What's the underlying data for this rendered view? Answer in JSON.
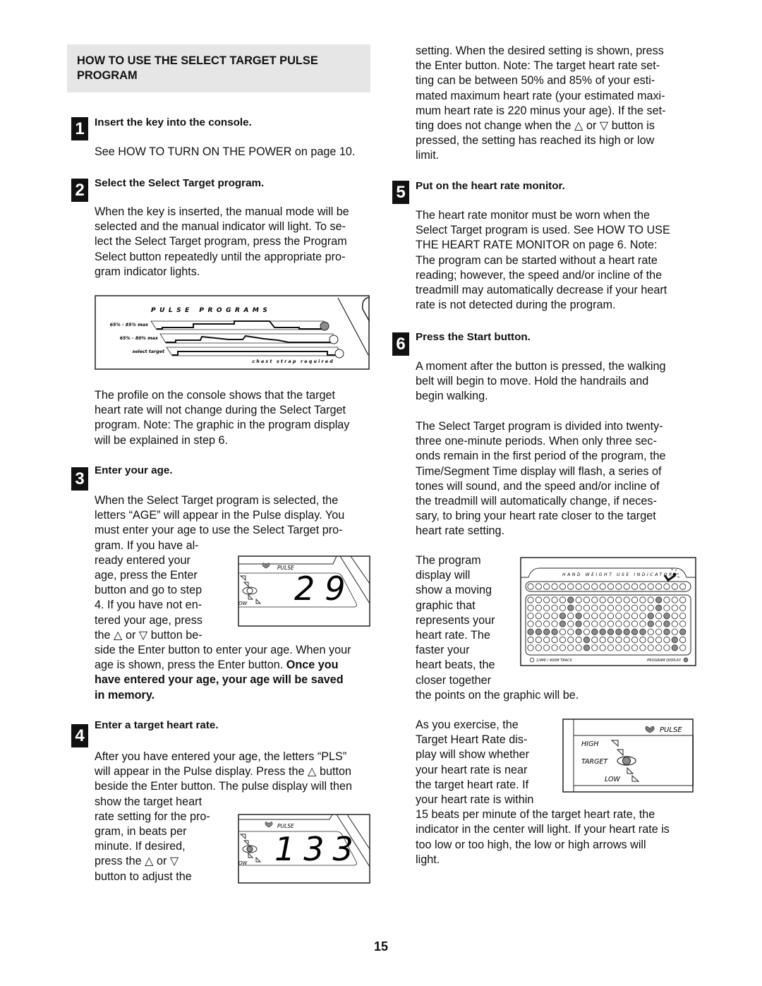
{
  "section_title": "HOW TO USE THE SELECT TARGET PULSE PROGRAM",
  "steps": [
    {
      "number": "1",
      "heading": "Insert the key into the console.",
      "body": "See HOW TO TURN ON THE POWER on page 10."
    },
    {
      "number": "2",
      "heading": "Select the Select Target program.",
      "body": "When the key is inserted, the manual mode will be selected and the manual indicator will light. To se-lect the Select Target program, press the Program Select button repeatedly until the appropriate pro-gram indicator lights."
    },
    {
      "number": "3",
      "heading": "Enter your age."
    },
    {
      "number": "4",
      "heading": "Enter a target heart rate."
    },
    {
      "number": "5",
      "heading": "Put on the heart rate monitor."
    },
    {
      "number": "6",
      "heading": "Press the Start button."
    }
  ],
  "step2_lines": [
    "When the key is inserted, the manual mode will be",
    "selected and the manual indicator will light. To se-",
    "lect the Select Target program, press the Program",
    "Select button repeatedly until the appropriate pro-",
    "gram indicator lights."
  ],
  "profile_para": [
    "The profile on the console shows that the target",
    "heart rate will not change during the Select Target",
    "program. Note: The graphic in the program display",
    "will be explained in step 6."
  ],
  "step3_lines_full": [
    "When the Select Target program is selected, the",
    "letters “AGE” will appear in the Pulse display. You",
    "must enter your age to use the Select Target pro-"
  ],
  "step3_lines_narrow": [
    "gram. If you have al-",
    "ready entered your",
    "age, press the Enter",
    "button and go to step",
    "4. If you have not en-",
    "tered your age, press",
    "the △ or ▽ button be-"
  ],
  "step3_lines_after": [
    "side the Enter button to enter your age. When your",
    "age is shown, press the Enter button."
  ],
  "step3_bold": [
    "Once you",
    "have entered your age, your age will be saved",
    "in memory."
  ],
  "step4_lines_full": [
    "After you have entered your age, the letters “PLS”",
    "will appear in the Pulse display. Press the △ button",
    "beside the Enter button. The pulse display will then"
  ],
  "step4_lines_narrow": [
    "show the target heart",
    "rate setting for the pro-",
    "gram, in beats per",
    "minute. If desired,",
    "press the △ or ▽",
    "button to adjust the"
  ],
  "right_top_lines": [
    "setting. When the desired setting is shown, press",
    "the Enter button. Note: The target heart rate set-",
    "ting can be between 50% and 85% of your esti-",
    "mated maximum heart rate (your estimated maxi-",
    "mum heart rate is 220 minus your age). If the set-",
    "ting does not change when the △ or ▽ button is",
    "pressed, the setting has reached its high or low",
    "limit."
  ],
  "step5_lines": [
    "The heart rate monitor must be worn when the",
    "Select Target program is used. See HOW TO USE",
    "THE HEART RATE MONITOR on page 6. Note:",
    "The program can be started without a heart rate",
    "reading; however, the speed and/or incline of the",
    "treadmill may automatically decrease if your heart",
    "rate is not detected during the program."
  ],
  "step6_lines_a": [
    "A moment after the button is pressed, the walking",
    "belt will begin to move. Hold the handrails and",
    "begin walking."
  ],
  "step6_lines_b": [
    "The Select Target program is divided into twenty-",
    "three one-minute periods. When only three sec-",
    "onds remain in the first period of the program, the",
    "Time/Segment Time display will flash, a series of",
    "tones will sound, and the speed and/or incline of",
    "the treadmill will automatically change, if neces-",
    "sary, to bring your heart rate closer to the target",
    "heart rate setting."
  ],
  "program_display_lines": [
    "The program",
    "display will",
    "show a moving",
    "graphic that",
    "represents your",
    "heart rate. The",
    "faster your",
    "heart beats, the",
    "closer together"
  ],
  "program_display_after": "the points on the graphic will be.",
  "target_lines_narrow": [
    "As you exercise, the",
    "Target Heart Rate dis-",
    "play will show whether",
    "your heart rate is near",
    "the target heart rate. If",
    "your heart rate is within"
  ],
  "target_lines_full": [
    "15 beats per minute of the target heart rate, the",
    "indicator in the center will light. If your heart rate is",
    "too low or too high, the low or high arrows will",
    "light."
  ],
  "pulse_programs_panel": {
    "title": "PULSE PROGRAMS",
    "rows": [
      {
        "label": "65% - 85% max",
        "indicator_lit": true
      },
      {
        "label": "65% - 80% max",
        "indicator_lit": false
      },
      {
        "label": "select target",
        "indicator_lit": false
      }
    ],
    "footer": "chest strap required"
  },
  "age_display": {
    "label": "PULSE",
    "value": "29",
    "side_label": "OW"
  },
  "target_hr_display": {
    "label": "PULSE",
    "value": "133",
    "side_label": "OW"
  },
  "program_display_panel": {
    "title": "HAND WEIGHT USE INDICATOR",
    "track_label": "1/4MI / 400M TRACK",
    "display_label": "PROGRAM DISPLAY",
    "columns": 20,
    "lit_rows": [
      [
        5,
        16
      ],
      [
        5,
        16
      ],
      [
        4,
        6,
        15,
        17
      ],
      [
        4,
        6,
        15,
        17
      ],
      [
        0,
        1,
        2,
        3,
        6,
        8,
        9,
        10,
        11,
        12,
        13,
        14,
        17,
        19
      ],
      [
        7,
        18
      ],
      [
        7,
        18
      ]
    ]
  },
  "target_indicator_panel": {
    "label": "PULSE",
    "high": "HIGH",
    "target": "TARGET",
    "low": "LOW"
  },
  "page_number": "15",
  "colors": {
    "lit": "#8c8c8c",
    "banner": "#e6e6e6"
  }
}
